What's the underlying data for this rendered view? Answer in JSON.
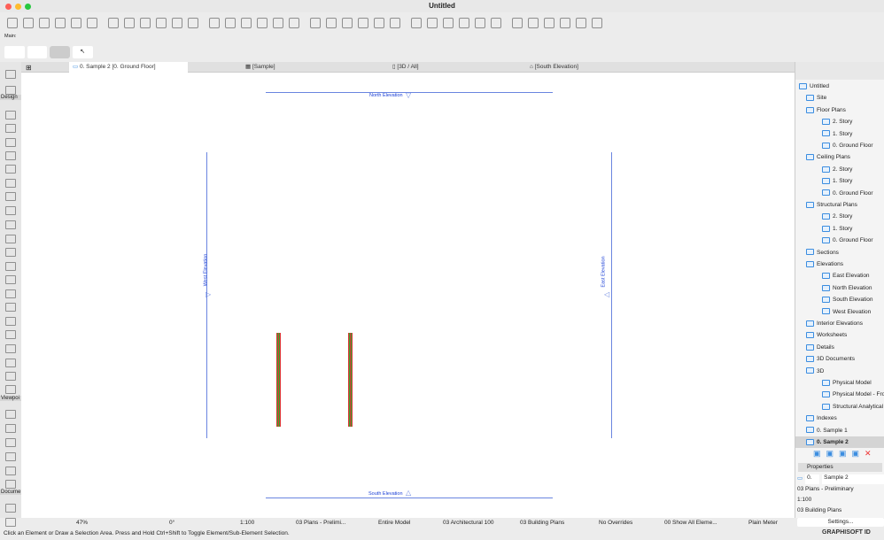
{
  "window": {
    "title": "Untitled"
  },
  "toolbar": {
    "main_label": "Main:"
  },
  "tabs": [
    {
      "label": "0. Sample 2 [0. Ground Floor]",
      "icon": "floor-plan-icon"
    },
    {
      "label": "[Sample]",
      "icon": "grid-icon"
    },
    {
      "label": "[3D / All]",
      "icon": "3d-icon"
    },
    {
      "label": "[South Elevation]",
      "icon": "elevation-icon"
    }
  ],
  "toolbox": {
    "sections": [
      "Design",
      "Viewpoi",
      "Docume"
    ]
  },
  "canvas": {
    "north": "North Elevation",
    "south": "South Elevation",
    "west": "West Elevation",
    "east": "East Elevation"
  },
  "navigator": {
    "items": [
      {
        "label": "Untitled",
        "level": 0
      },
      {
        "label": "Site",
        "level": 1
      },
      {
        "label": "Floor Plans",
        "level": 1
      },
      {
        "label": "2. Story",
        "level": 2
      },
      {
        "label": "1. Story",
        "level": 2
      },
      {
        "label": "0. Ground Floor",
        "level": 2
      },
      {
        "label": "Ceiling Plans",
        "level": 1
      },
      {
        "label": "2. Story",
        "level": 2
      },
      {
        "label": "1. Story",
        "level": 2
      },
      {
        "label": "0. Ground Floor",
        "level": 2
      },
      {
        "label": "Structural Plans",
        "level": 1
      },
      {
        "label": "2. Story",
        "level": 2
      },
      {
        "label": "1. Story",
        "level": 2
      },
      {
        "label": "0. Ground Floor",
        "level": 2
      },
      {
        "label": "Sections",
        "level": 1
      },
      {
        "label": "Elevations",
        "level": 1
      },
      {
        "label": "East Elevation",
        "level": 2
      },
      {
        "label": "North Elevation",
        "level": 2
      },
      {
        "label": "South Elevation",
        "level": 2
      },
      {
        "label": "West Elevation",
        "level": 2
      },
      {
        "label": "Interior Elevations",
        "level": 1
      },
      {
        "label": "Worksheets",
        "level": 1
      },
      {
        "label": "Details",
        "level": 1
      },
      {
        "label": "3D Documents",
        "level": 1
      },
      {
        "label": "3D",
        "level": 1
      },
      {
        "label": "Physical Model",
        "level": 2
      },
      {
        "label": "Physical Model - Front",
        "level": 2
      },
      {
        "label": "Structural Analytical Model",
        "level": 2
      },
      {
        "label": "Indexes",
        "level": 1
      },
      {
        "label": "0. Sample 1",
        "level": 1
      },
      {
        "label": "0. Sample 2",
        "level": 1,
        "selected": true
      }
    ]
  },
  "properties": {
    "title": "Properties",
    "id": "0.",
    "name": "Sample 2",
    "layer_combo": "03 Plans - Preliminary",
    "scale": "1:100",
    "view_set": "03 Building Plans",
    "settings": "Settings..."
  },
  "status": {
    "zoom": "47%",
    "angle": "0°",
    "scale": "1:100",
    "layers": "03 Plans - Prelimi...",
    "model": "Entire Model",
    "pen": "03 Architectural 100",
    "mvo": "03 Building Plans",
    "overrides": "No Overrides",
    "renovation": "00 Show All Eleme...",
    "dimension": "Plain Meter"
  },
  "message": "Click an Element or Draw a Selection Area. Press and Hold Ctrl+Shift to Toggle Element/Sub-Element Selection.",
  "brand": "GRAPHISOFT ID"
}
